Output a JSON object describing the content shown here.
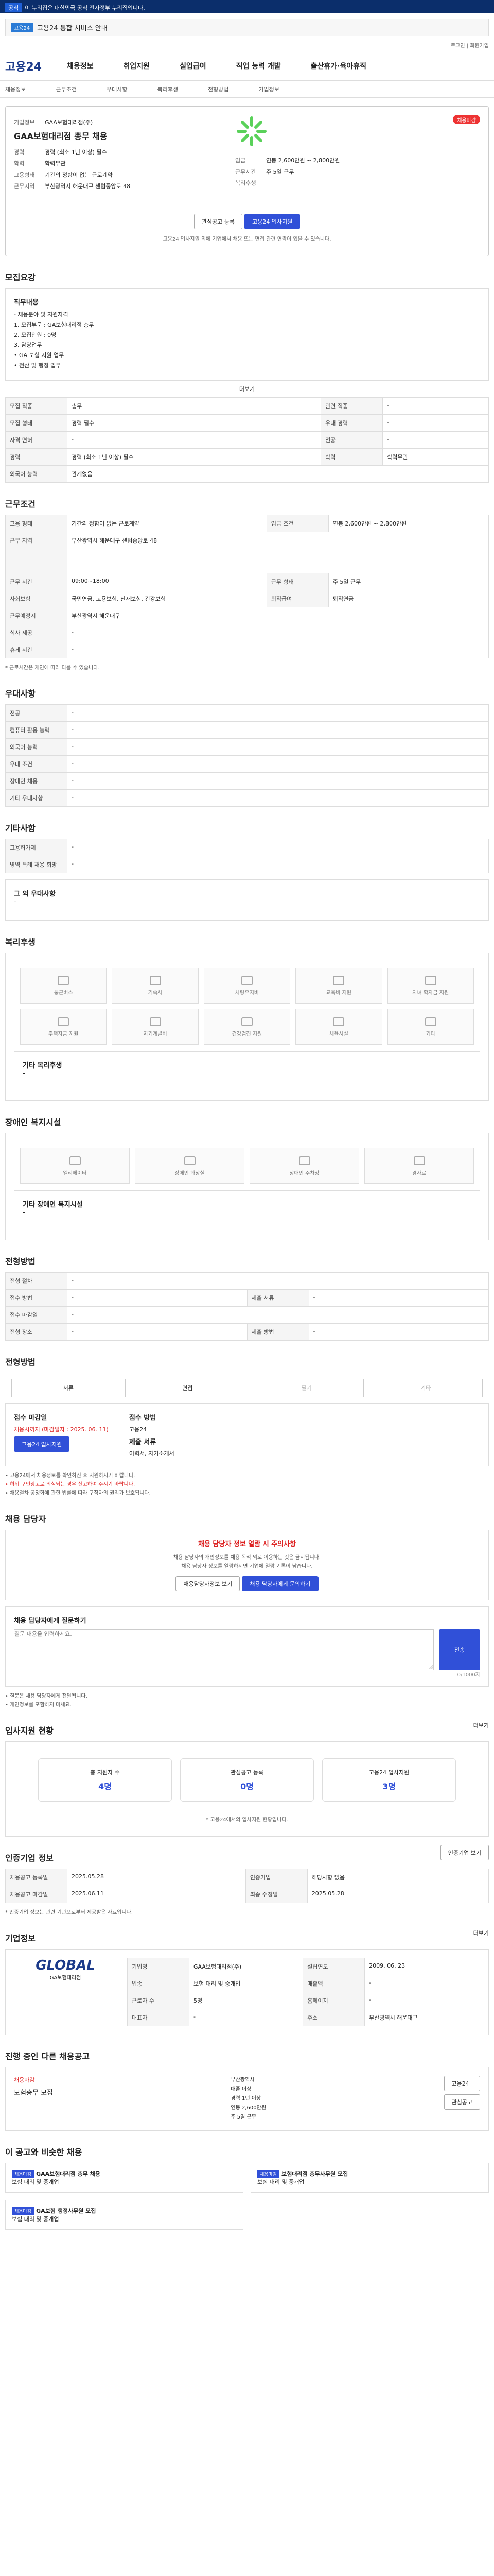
{
  "top": {
    "tag": "공식",
    "text": "이 누리집은 대한민국 공식 전자정부 누리집입니다."
  },
  "gov": {
    "label": "고용24",
    "text": "고용24 통합 서비스 안내"
  },
  "gnb": {
    "logo": "고용24",
    "menu": [
      "채용정보",
      "취업지원",
      "실업급여",
      "직업 능력 개발",
      "출산휴가·육아휴직"
    ],
    "util": [
      "로그인",
      "회원가입"
    ]
  },
  "crumbs": [
    "채용정보",
    "근무조건",
    "우대사항",
    "복리후생",
    "전형방법",
    "기업정보"
  ],
  "corp": {
    "title": "GAA보험대리점 총무 채용",
    "status": "채용마감",
    "company_label": "기업정보",
    "company": "GAA보험대리점(주)",
    "rows": [
      [
        "경력",
        "경력 (최소 1년 이상) 필수"
      ],
      [
        "학력",
        "학력무관"
      ],
      [
        "고용형태",
        "기간의 정함이 없는 근로계약"
      ],
      [
        "근무지역",
        "부산광역시 해운대구 센텀중앙로 48"
      ]
    ],
    "wage_label": "임금",
    "wage": "연봉 2,600만원 ~ 2,800만원",
    "work_label": "근무시간",
    "work": "주 5일 근무",
    "welfare_label": "복리후생",
    "apply": [
      "관심공고 등록",
      "고용24 입사지원"
    ],
    "note": "고용24 입사지원 외에 기업에서 채용 또는 면접 관련 연락이 있을 수 있습니다."
  },
  "recruit": {
    "sec": "모집요강",
    "job_title": "직무내용",
    "job_lines": [
      "- 채용분야 및 지원자격",
      "1. 모집부문 : GA보험대리점 총무",
      "2. 모집인원 : 0명",
      "3. 담당업무",
      "• GA 보험 지원 업무",
      "• 전산 및 행정 업무"
    ],
    "more": "더보기",
    "rows": [
      [
        "모집 직종",
        "총무",
        "관련 직종",
        "-"
      ],
      [
        "모집 형태",
        "경력 필수",
        "우대 경력",
        "-"
      ],
      [
        "자격 면허",
        "-",
        "전공",
        "-"
      ],
      [
        "경력",
        "경력 (최소 1년 이상) 필수",
        "학력",
        "학력무관"
      ],
      [
        "외국어 능력",
        "관계없음",
        "",
        "-"
      ]
    ]
  },
  "cond": {
    "sec": "근무조건",
    "rows": [
      [
        "고용 형태",
        "기간의 정함이 없는 근로계약",
        "임금 조건",
        "연봉 2,600만원 ~ 2,800만원"
      ],
      [
        "근무 지역",
        "부산광역시 해운대구 센텀중앙로 48",
        "",
        ""
      ],
      [
        "근무 시간",
        "09:00~18:00",
        "근무 형태",
        "주 5일 근무"
      ],
      [
        "사회보험",
        "국민연금, 고용보험, 산재보험, 건강보험",
        "퇴직급여",
        "퇴직연금"
      ],
      [
        "근무예정지",
        "부산광역시 해운대구",
        "",
        ""
      ],
      [
        "식사 제공",
        "-",
        "",
        ""
      ],
      [
        "휴게 시간",
        "-",
        "",
        ""
      ]
    ],
    "note": "* 근로시간은 개인에 따라 다를 수 있습니다."
  },
  "pref": {
    "sec": "우대사항",
    "rows": [
      [
        "전공",
        "-"
      ],
      [
        "컴퓨터 활용 능력",
        "-"
      ],
      [
        "외국어 능력",
        "-"
      ],
      [
        "우대 조건",
        "-"
      ],
      [
        "장애인 채용",
        "-"
      ],
      [
        "기타 우대사항",
        "-"
      ]
    ]
  },
  "other": {
    "sec": "기타사항",
    "rows": [
      [
        "고용허가제",
        "-"
      ],
      [
        "병역 특례 채용 희망",
        "-"
      ]
    ],
    "etc_label": "그 외 우대사항",
    "etc": "-"
  },
  "welfare": {
    "sec": "복리후생",
    "items": [
      "통근버스",
      "기숙사",
      "차량유지비",
      "교육비 지원",
      "자녀 학자금 지원",
      "주택자금 지원",
      "자기계발비",
      "건강검진 지원",
      "체육시설",
      "기타"
    ],
    "other_label": "기타 복리후생",
    "other": "-"
  },
  "disabled": {
    "sec": "장애인 복지시설",
    "items": [
      "엘리베이터",
      "장애인 화장실",
      "장애인 주차장",
      "경사로"
    ],
    "other_label": "기타 장애인 복지시설",
    "other": "-"
  },
  "screen": {
    "sec": "전형방법",
    "rows": [
      [
        "전형 절차",
        "-",
        "",
        ""
      ],
      [
        "접수 방법",
        "-",
        "제출 서류",
        "-"
      ],
      [
        "접수 마감일",
        "-",
        "",
        "-"
      ],
      [
        "전형 장소",
        "-",
        "제출 방법",
        "-"
      ]
    ]
  },
  "apply": {
    "sec": "전형방법",
    "methods": [
      "서류",
      "면접",
      "필기",
      "기타"
    ],
    "deadline_label": "접수 마감일",
    "deadline": "채용시까지 (마감일자 : 2025. 06. 11)",
    "apply_btn": "고용24 입사지원",
    "method_label": "접수 방법",
    "method": "고용24",
    "doc_label": "제출 서류",
    "doc": "이력서, 자기소개서",
    "notice": [
      "• 고용24에서 채용정보를 확인하신 후 지원하시기 바랍니다.",
      "• 허위 구인광고로 의심되는 경우 신고하여 주시기 바랍니다.",
      "• 채용절차 공정화에 관한 법률에 따라 구직자의 권리가 보호됩니다."
    ]
  },
  "contact": {
    "sec": "채용 담당자",
    "warn": "채용 담당자 정보 열람 시 주의사항",
    "lines": [
      "채용 담당자의 개인정보를 채용 목적 외로 이용하는 것은 금지됩니다.",
      "채용 담당자 정보를 열람하시면 기업에 열람 기록이 남습니다."
    ],
    "btns": [
      "채용담당자정보 보기",
      "채용 담당자에게 문의하기"
    ],
    "q_label": "채용 담당자에게 질문하기",
    "q_ph": "질문 내용을 입력하세요.",
    "q_btn": "전송",
    "q_count": "0/1000자",
    "tips": [
      "• 질문은 채용 담당자에게 전달됩니다.",
      "• 개인정보를 포함하지 마세요."
    ]
  },
  "status": {
    "sec": "입사지원 현황",
    "more": "더보기",
    "items": [
      [
        "총 지원자 수",
        "4명"
      ],
      [
        "관심공고 등록",
        "0명"
      ],
      [
        "고용24 입사지원",
        "3명"
      ]
    ],
    "note": "* 고용24에서의 입사지원 현황입니다."
  },
  "cert": {
    "sec": "인증기업 정보",
    "btn": "인증기업 보기",
    "rows": [
      [
        "채용공고 등록일",
        "2025.05.28",
        "인증기업",
        "해당사항 없음"
      ],
      [
        "채용공고 마감일",
        "2025.06.11",
        "최종 수정일",
        "2025.05.28"
      ]
    ],
    "note": "* 인증기업 정보는 관련 기관으로부터 제공받은 자료입니다."
  },
  "company": {
    "sec": "기업정보",
    "more": "더보기",
    "logo": "GLOBAL",
    "logo_sub": "GA보험대리점",
    "rows": [
      [
        "기업명",
        "GAA보험대리점(주)",
        "설립연도",
        "2009. 06. 23"
      ],
      [
        "업종",
        "보험 대리 및 중개업",
        "매출액",
        "-"
      ],
      [
        "근로자 수",
        "5명",
        "홈페이지",
        "-"
      ],
      [
        "대표자",
        "-",
        "주소",
        "부산광역시 해운대구"
      ]
    ]
  },
  "related": {
    "sec": "진행 중인 다른 채용공고",
    "title": "채용마감",
    "sub": "보험총무 모집",
    "info": [
      "부산광역시",
      "대졸 이상",
      "경력 1년 이상",
      "연봉 2,600만원",
      "주 5일 근무"
    ],
    "side": [
      "고용24",
      "관심공고"
    ]
  },
  "similar": {
    "sec": "이 공고와 비슷한 채용",
    "items": [
      {
        "badge": "채용마감",
        "t": "GAA보험대리점 총무 채용",
        "sub": "보험 대리 및 중개업"
      },
      {
        "badge": "채용마감",
        "t": "보험대리점 총무사무원 모집",
        "sub": "보험 대리 및 중개업"
      },
      {
        "badge": "채용마감",
        "t": "GA보험 행정사무원 모집",
        "sub": "보험 대리 및 중개업"
      }
    ]
  },
  "colors": {
    "brand": "#1c3b8a",
    "accent": "#3050d8",
    "warn": "#d22"
  }
}
